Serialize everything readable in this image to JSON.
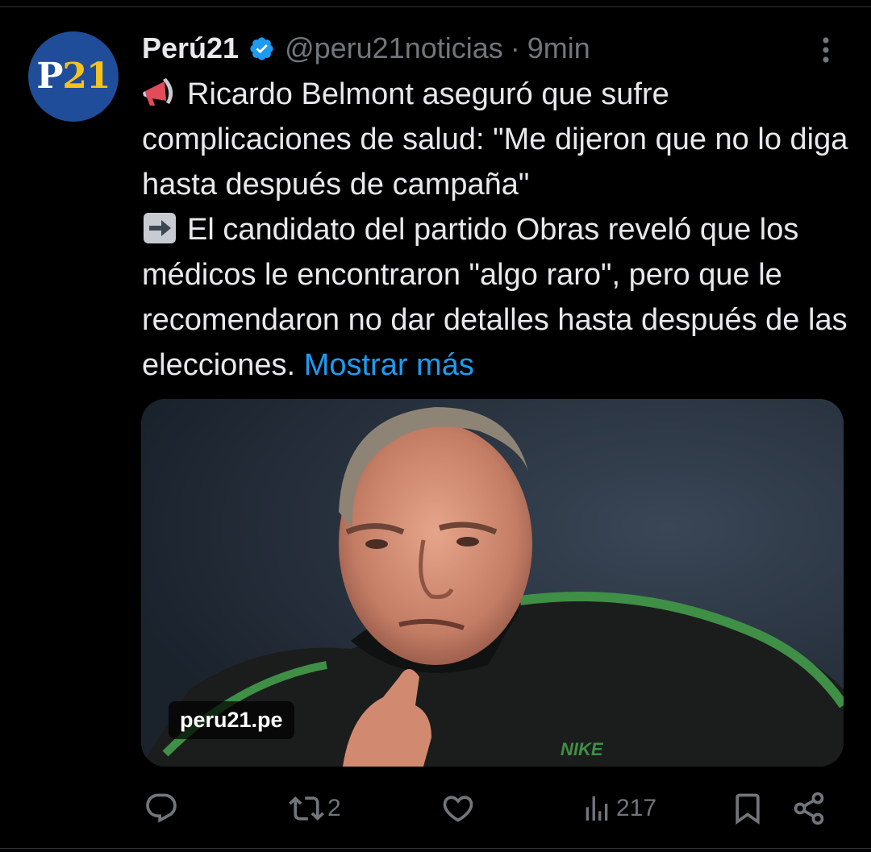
{
  "account": {
    "avatar_text_p": "P",
    "avatar_text_num": "21",
    "display_name": "Perú21",
    "handle": "@peru21noticias",
    "separator": "·",
    "time": "9min",
    "verified": true
  },
  "tweet": {
    "line1_emoji": "megaphone-emoji",
    "line1": "Ricardo Belmont aseguró que sufre complicaciones de salud: \"Me dijeron que no lo diga hasta después de campaña\"",
    "line2_emoji": "right-arrow-emoji",
    "line2": "El candidato del partido Obras reveló que los médicos le encontraron \"algo raro\", pero que le recomendaron no dar detalles hasta después de las elecciones.",
    "show_more": "Mostrar más"
  },
  "media": {
    "domain": "peru21.pe",
    "jacket_brand": "NIKE"
  },
  "actions": {
    "reply_count": "",
    "retweet_count": "2",
    "like_count": "",
    "views_count": "217"
  },
  "colors": {
    "background": "#000000",
    "text": "#e7e9ea",
    "muted": "#71767b",
    "link": "#1d9bf0",
    "verified": "#1d9bf0",
    "avatar_bg": "#1f4d99",
    "avatar_accent": "#f7c21a"
  }
}
